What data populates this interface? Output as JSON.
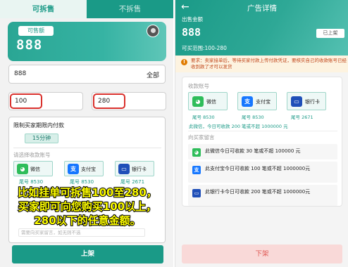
{
  "left": {
    "tabs": {
      "active": "可拆售",
      "inactive": "不拆售"
    },
    "sell_label": "可售额",
    "sell_amount": "888",
    "amount_value": "888",
    "amount_all": "全部",
    "range_min": "100",
    "range_max": "280",
    "time_limit_title": "限制买家期限内付款",
    "time_limit_value": "15分钟",
    "account_title": "请选择收款账号",
    "accounts": [
      {
        "label": "微信",
        "tail": "尾号 8530",
        "icon": "wechat-icon"
      },
      {
        "label": "支付宝",
        "tail": "尾号 8530",
        "icon": "alipay-icon"
      },
      {
        "label": "银行卡",
        "tail": "尾号 2671",
        "icon": "bank-card-icon"
      }
    ],
    "message_placeholder": "需要向买家留言，如无则不选",
    "overlay_lines": [
      "比如挂单可拆售100至280，",
      "买家即可向您购买100以上，",
      "280以下的任意金额。"
    ],
    "shelf_button": "上架"
  },
  "right": {
    "title": "广告详情",
    "sell_label": "出售金额",
    "amount": "888",
    "status_badge": "已上架",
    "range": "可买范围:100-280",
    "notice": "要求：卖家接单后，等待买家付款上传付款凭证，要核实自己的收款账号已经收到款了才可以发货",
    "account_title": "收款账号",
    "accounts": [
      {
        "label": "微信",
        "tail": "尾号 8530",
        "icon": "wechat-icon"
      },
      {
        "label": "支付宝",
        "tail": "尾号 8530",
        "icon": "alipay-icon"
      },
      {
        "label": "银行卡",
        "tail": "尾号 2671",
        "icon": "bank-card-icon"
      }
    ],
    "summary": "此微信，今日可收款 200 笔或不超 1000000 元",
    "message_title": "向买家留言",
    "messages": [
      {
        "text": "此微信今日可收款 30 笔或不超 100000 元",
        "icon": "wechat-icon"
      },
      {
        "text": "此支付宝今日可收款 100 笔或不超 1000000元",
        "icon": "alipay-icon"
      },
      {
        "text": "此银行卡今日可收款 200 笔或不超 1000000元",
        "icon": "bank-card-icon"
      }
    ],
    "order_button": "下架"
  },
  "colors": {
    "brand": "#1a9a87",
    "highlight_border": "#d9302c",
    "notice_text": "#c0461a",
    "overlay_text": "#ffff00"
  }
}
